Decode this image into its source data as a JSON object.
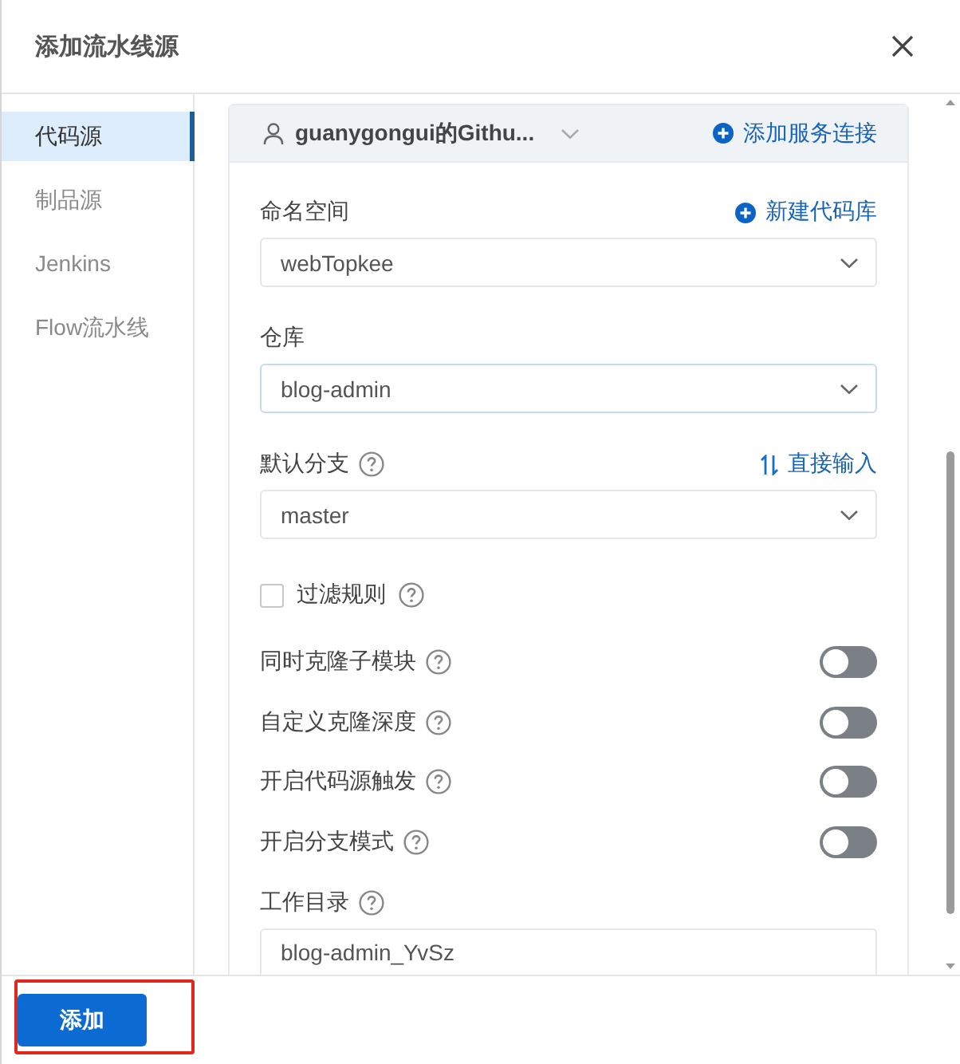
{
  "dialog": {
    "title": "添加流水线源"
  },
  "sidebar": {
    "items": [
      {
        "label": "代码源",
        "selected": true
      },
      {
        "label": "制品源",
        "selected": false
      },
      {
        "label": "Jenkins",
        "selected": false
      },
      {
        "label": "Flow流水线",
        "selected": false
      }
    ]
  },
  "connection": {
    "account": "guanygongui的Githu...",
    "action": {
      "kind": "add",
      "label": "添加服务连接"
    }
  },
  "fields": [
    {
      "kind": "select",
      "label": "命名空间",
      "help": false,
      "action": {
        "kind": "add",
        "label": "新建代码库"
      },
      "value": "webTopkee",
      "focused": false
    },
    {
      "kind": "select",
      "label": "仓库",
      "help": false,
      "value": "blog-admin",
      "focused": true
    },
    {
      "kind": "select",
      "label": "默认分支",
      "help": true,
      "action": {
        "kind": "switch",
        "label": "直接输入"
      },
      "value": "master",
      "focused": false
    },
    {
      "kind": "checkbox",
      "label": "过滤规则",
      "help": true,
      "checked": false
    },
    {
      "kind": "toggle",
      "label": "同时克隆子模块",
      "help": true,
      "on": false
    },
    {
      "kind": "toggle",
      "label": "自定义克隆深度",
      "help": true,
      "on": false
    },
    {
      "kind": "toggle",
      "label": "开启代码源触发",
      "help": true,
      "on": false
    },
    {
      "kind": "toggle",
      "label": "开启分支模式",
      "help": true,
      "on": false
    },
    {
      "kind": "text",
      "label": "工作目录",
      "help": true,
      "value": "blog-admin_YvSz",
      "focused": false
    }
  ],
  "footer": {
    "button": {
      "label": "添加",
      "highlighted": true
    }
  }
}
